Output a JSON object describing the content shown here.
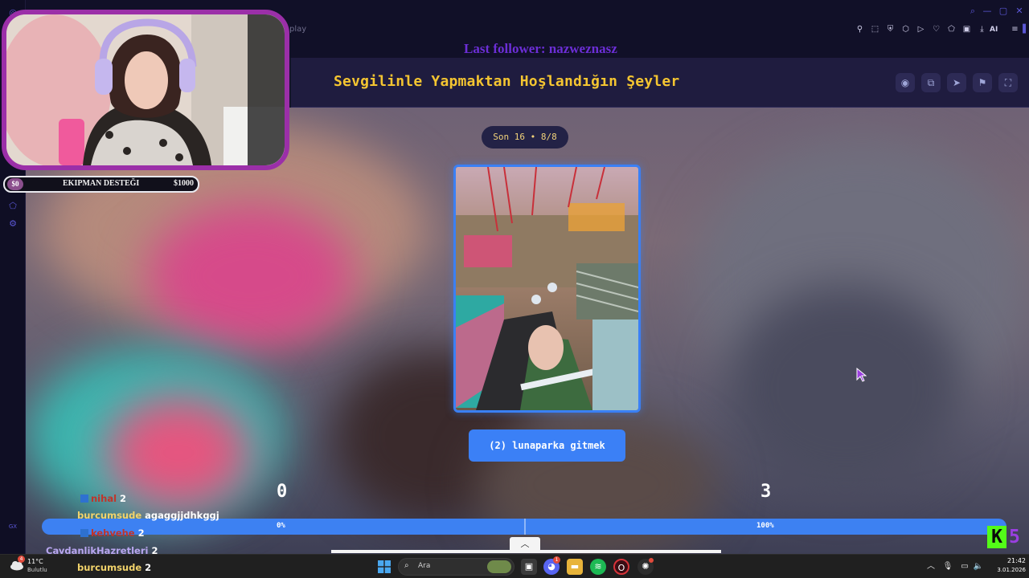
{
  "browser": {
    "tab_fragment": "play",
    "ai_label": "AI"
  },
  "overlay": {
    "follower_text": "Last follower: nazweznasz",
    "donation": {
      "start": "$0",
      "label": "EKIPMAN DESTEĞI",
      "goal": "$1000"
    }
  },
  "game": {
    "title": "Sevgilinle Yapmaktan Hoşlandığın Şeyler",
    "round_pill": "Son 16 • 8/8",
    "choice_label": "(2) lunaparka gitmek",
    "score_left": "0",
    "score_right": "3",
    "progress": {
      "left_pct": "0%",
      "right_pct": "100%",
      "left_fraction": 0,
      "right_fraction": 1
    }
  },
  "chat": [
    {
      "user": "nihal",
      "message": "2",
      "user_color": "#c0342a",
      "badge": true
    },
    {
      "user": "burcumsude",
      "message": "agaggjjdhkggj",
      "user_color": "#f2d36b",
      "badge": false
    },
    {
      "user": "kehvehe",
      "message": "2",
      "user_color": "#c0342a",
      "badge": true
    },
    {
      "user": "CaydanlikHazretleri",
      "message": "2",
      "user_color": "#b9a7f0",
      "badge": false
    },
    {
      "user": "burcumsude",
      "message": "2",
      "user_color": "#f2d36b",
      "badge": false
    }
  ],
  "brand": {
    "logo_letter": "K",
    "logo_number": "5"
  },
  "taskbar": {
    "weather_temp": "11°C",
    "weather_desc": "Bulutlu",
    "weather_badge": "4",
    "search_placeholder": "Ara",
    "discord_badge": "1",
    "time": "21:42",
    "date": "3.01.2026"
  },
  "colors": {
    "accent_blue": "#3b80f6",
    "title_yellow": "#f4c531",
    "webcam_border": "#9b2fa8",
    "kick_green": "#53fc18"
  }
}
